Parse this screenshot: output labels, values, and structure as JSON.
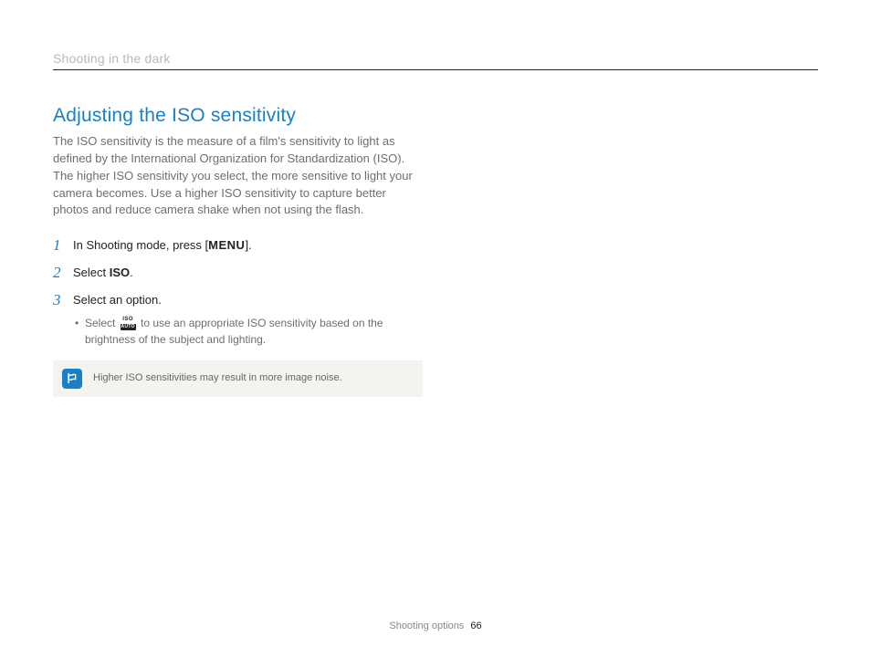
{
  "header": {
    "breadcrumb": "Shooting in the dark"
  },
  "section": {
    "title": "Adjusting the ISO sensitivity",
    "intro": "The ISO sensitivity is the measure of a film's sensitivity to light as defined by the International Organization for Standardization (ISO). The higher ISO sensitivity you select, the more sensitive to light your camera becomes. Use a higher ISO sensitivity to capture better photos and reduce camera shake when not using the flash."
  },
  "steps": {
    "s1_num": "1",
    "s1_a": "In Shooting mode, press [",
    "s1_menu": "MENU",
    "s1_b": "].",
    "s2_num": "2",
    "s2_a": "Select ",
    "s2_iso": "ISO",
    "s2_b": ".",
    "s3_num": "3",
    "s3_text": "Select an option.",
    "s3_sub_a": "Select ",
    "s3_sub_b": " to use an appropriate ISO sensitivity based on the brightness of the subject and lighting.",
    "icon_top": "ISO",
    "icon_bot": "AUTO"
  },
  "note": {
    "text": "Higher ISO sensitivities may result in more image noise."
  },
  "footer": {
    "section": "Shooting options",
    "page": "66"
  }
}
